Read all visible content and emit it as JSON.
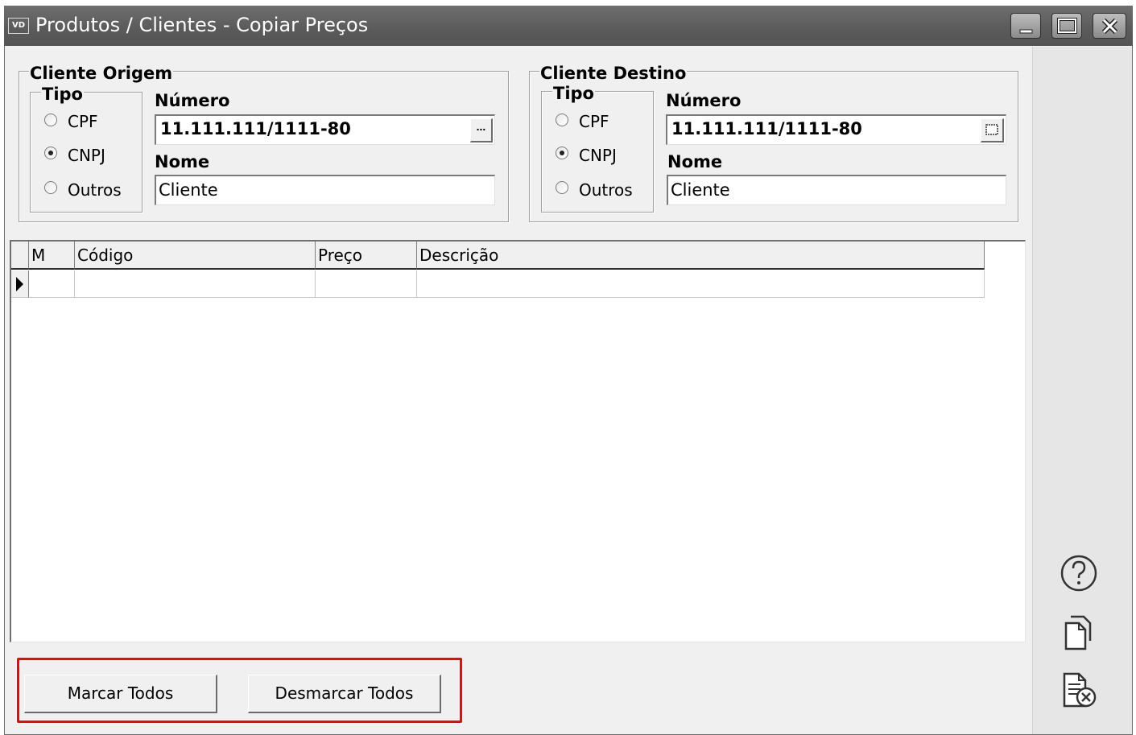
{
  "window": {
    "app_icon_text": "VD",
    "title": "Produtos / Clientes - Copiar Preços"
  },
  "origem": {
    "legend": "Cliente Origem",
    "tipo_legend": "Tipo",
    "options": [
      "CPF",
      "CNPJ",
      "Outros"
    ],
    "selected": "CNPJ",
    "numero_label": "Número",
    "numero_value": "11.111.111/1111-80",
    "lookup_label": "...",
    "nome_label": "Nome",
    "nome_value": "Cliente"
  },
  "destino": {
    "legend": "Cliente Destino",
    "tipo_legend": "Tipo",
    "options": [
      "CPF",
      "CNPJ",
      "Outros"
    ],
    "selected": "CNPJ",
    "numero_label": "Número",
    "numero_value": "11.111.111/1111-80",
    "nome_label": "Nome",
    "nome_value": "Cliente"
  },
  "grid": {
    "columns": [
      "M",
      "Código",
      "Preço",
      "Descrição"
    ],
    "rows": [
      [
        "",
        "",
        "",
        ""
      ]
    ]
  },
  "buttons": {
    "marcar": "Marcar Todos",
    "desmarcar": "Desmarcar Todos"
  },
  "side_icons": [
    "help-icon",
    "copy-icon",
    "cancel-document-icon"
  ],
  "colors": {
    "titlebar": "#5a5a5a",
    "highlight": "#ff0000",
    "window_bg": "#f0f0f0"
  }
}
